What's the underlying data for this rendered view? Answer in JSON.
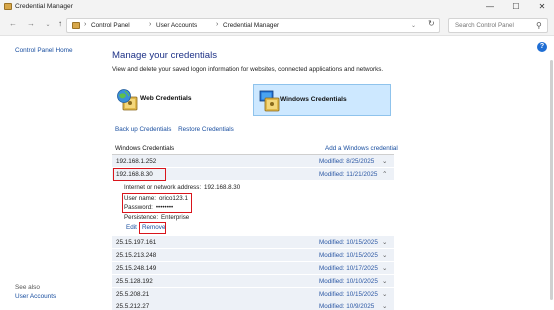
{
  "window": {
    "title": "Credential Manager",
    "minimize_glyph": "—",
    "maximize_glyph": "☐",
    "close_glyph": "✕"
  },
  "nav": {
    "back_glyph": "←",
    "forward_glyph": "→",
    "down_glyph": "⌄",
    "up_glyph": "↑",
    "refresh_glyph": "↻",
    "dropdown_glyph": "⌄",
    "sep_glyph": "›",
    "breadcrumb": [
      "Control Panel",
      "User Accounts",
      "Credential Manager"
    ]
  },
  "search": {
    "placeholder": "Search Control Panel",
    "icon_glyph": "⚲"
  },
  "left": {
    "home": "Control Panel Home",
    "see_also": "See also",
    "user_accounts": "User Accounts"
  },
  "main": {
    "help_glyph": "?",
    "title": "Manage your credentials",
    "description": "View and delete your saved logon information for websites, connected applications and networks.",
    "web_label": "Web Credentials",
    "windows_label": "Windows Credentials",
    "backup_first": "B",
    "backup_rest": "ack up Credentials",
    "restore_first": "R",
    "restore_rest": "estore Credentials",
    "section": "Windows Credentials",
    "add": "Add a Windows credential"
  },
  "credentials": [
    {
      "name": "192.168.1.252",
      "modified": "Modified:  8/25/2025",
      "chevron": "⌄"
    },
    {
      "name": "192.168.8.30",
      "modified": "Modified:  11/21/2025",
      "chevron": "⌃"
    },
    {
      "name": "25.15.197.161",
      "modified": "Modified:  10/15/2025",
      "chevron": "⌄"
    },
    {
      "name": "25.15.213.248",
      "modified": "Modified:  10/15/2025",
      "chevron": "⌄"
    },
    {
      "name": "25.15.248.149",
      "modified": "Modified:  10/17/2025",
      "chevron": "⌄"
    },
    {
      "name": "25.5.128.192",
      "modified": "Modified:  10/10/2025",
      "chevron": "⌄"
    },
    {
      "name": "25.5.208.21",
      "modified": "Modified:  10/15/2025",
      "chevron": "⌄"
    },
    {
      "name": "25.5.212.27",
      "modified": "Modified:  10/9/2025",
      "chevron": "⌄"
    }
  ],
  "details": {
    "address_label": "Internet or network address:",
    "address_value": "192.168.8.30",
    "user_label": "User name:",
    "user_value": "orico123.1",
    "pass_label": "Password:",
    "pass_value": "••••••••",
    "persist_label": "Persistence:",
    "persist_value": "Enterprise",
    "edit": "Edit",
    "remove": "Remove"
  },
  "colors": {
    "accent": "#1a4fa0",
    "highlight": "#d9151c",
    "selected_tile": "#cde8ff",
    "row_bg": "#edf1f7"
  }
}
